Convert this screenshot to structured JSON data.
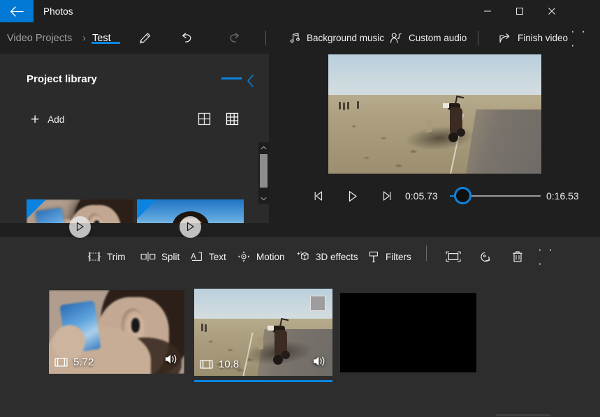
{
  "window": {
    "app_title": "Photos",
    "back_icon": "back-arrow-icon",
    "controls": {
      "minimize": "minimize-icon",
      "maximize": "maximize-icon",
      "close": "close-icon"
    }
  },
  "breadcrumb": {
    "root": "Video Projects",
    "separator": "›",
    "current": "Test"
  },
  "command_bar": {
    "edit_icon": "pencil-icon",
    "undo_icon": "undo-icon",
    "redo_icon": "redo-icon",
    "background_music": {
      "label": "Background music",
      "icon": "music-note-icon"
    },
    "custom_audio": {
      "label": "Custom audio",
      "icon": "person-audio-icon"
    },
    "finish_video": {
      "label": "Finish video",
      "icon": "share-export-icon"
    },
    "more_label": "· · ·"
  },
  "library": {
    "title": "Project library",
    "collapse_icon": "chevron-left-icon",
    "add": {
      "label": "Add",
      "icon": "plus-icon"
    },
    "view_modes": [
      {
        "name": "large-grid",
        "icon": "grid-2x2-icon",
        "selected": false
      },
      {
        "name": "small-grid",
        "icon": "grid-3x3-icon",
        "selected": true
      }
    ],
    "items": [
      {
        "name": "library-clip-1",
        "art": "earbuds-phone",
        "play_icon": "play-icon",
        "in_project": true
      },
      {
        "name": "library-clip-2",
        "art": "desert-selfie",
        "play_icon": "play-icon",
        "in_project": true
      }
    ],
    "scrollbar": {
      "up_icon": "chevron-up-icon",
      "down_icon": "chevron-down-icon"
    }
  },
  "player": {
    "prev_frame_icon": "previous-frame-icon",
    "play_icon": "play-icon",
    "next_frame_icon": "next-frame-icon",
    "current_time": "0:05.73",
    "total_time": "0:16.53",
    "fullscreen_icon": "expand-icon",
    "progress_percent": 17
  },
  "edit_toolbar": {
    "items": [
      {
        "label": "Trim",
        "icon": "trim-icon"
      },
      {
        "label": "Split",
        "icon": "split-icon"
      },
      {
        "label": "Text",
        "icon": "text-icon"
      },
      {
        "label": "Motion",
        "icon": "motion-icon"
      },
      {
        "label": "3D effects",
        "icon": "3d-effects-icon"
      },
      {
        "label": "Filters",
        "icon": "filters-icon"
      }
    ],
    "icon_buttons": [
      {
        "name": "aspect-ratio",
        "icon": "aspect-ratio-icon"
      },
      {
        "name": "rotate",
        "icon": "rotate-icon"
      },
      {
        "name": "delete",
        "icon": "trash-icon"
      }
    ],
    "more_label": "· · ·"
  },
  "storyboard": {
    "clips": [
      {
        "name": "storyboard-clip-1",
        "duration": "5.72",
        "duration_icon": "film-strip-icon",
        "audio_icon": "speaker-on-icon",
        "selected": false,
        "art": "earbuds-phone"
      },
      {
        "name": "storyboard-clip-2",
        "duration": "10.8",
        "duration_icon": "film-strip-icon",
        "audio_icon": "speaker-on-icon",
        "selected": true,
        "art": "desert-motorcycle"
      },
      {
        "name": "storyboard-clip-3",
        "duration": "",
        "selected": false,
        "art": "black-frame"
      }
    ]
  },
  "colors": {
    "accent": "#0a84e0",
    "back_button": "#0078d4",
    "window_bg": "#1f1f1f",
    "panel_bg": "#2b2b2b",
    "timeline_bg": "#2d2d2d",
    "text": "#ffffff",
    "text_dim": "#a0a0a0"
  }
}
